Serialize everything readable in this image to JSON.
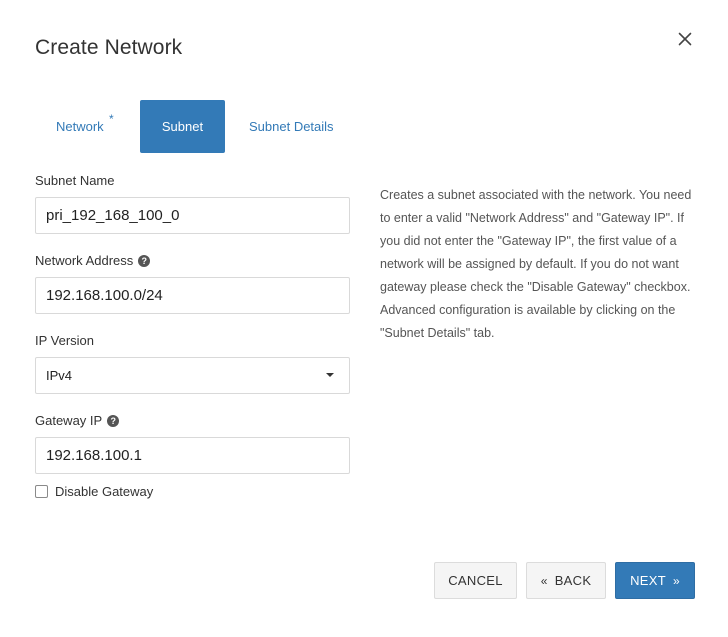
{
  "modal": {
    "title": "Create Network",
    "close_icon": "close-icon"
  },
  "tabs": [
    {
      "label": "Network",
      "required_marker": "*",
      "active": false
    },
    {
      "label": "Subnet",
      "active": true
    },
    {
      "label": "Subnet Details",
      "active": false
    }
  ],
  "form": {
    "subnet_name": {
      "label": "Subnet Name",
      "value": "pri_192_168_100_0"
    },
    "network_address": {
      "label": "Network Address",
      "help_icon": "question-icon",
      "value": "192.168.100.0/24"
    },
    "ip_version": {
      "label": "IP Version",
      "selected": "IPv4"
    },
    "gateway_ip": {
      "label": "Gateway IP",
      "help_icon": "question-icon",
      "value": "192.168.100.1"
    },
    "disable_gateway": {
      "label": "Disable Gateway",
      "checked": false
    }
  },
  "help_text": "Creates a subnet associated with the network. You need to enter a valid \"Network Address\" and \"Gateway IP\". If you did not enter the \"Gateway IP\", the first value of a network will be assigned by default. If you do not want gateway please check the \"Disable Gateway\" checkbox. Advanced configuration is available by clicking on the \"Subnet Details\" tab.",
  "footer": {
    "cancel_label": "CANCEL",
    "back_arrow": "«",
    "back_label": "BACK",
    "next_label": "NEXT",
    "next_arrow": "»"
  },
  "colors": {
    "primary": "#337ab7",
    "text": "#333333",
    "muted_text": "#555555",
    "border": "#d9d9d9"
  }
}
